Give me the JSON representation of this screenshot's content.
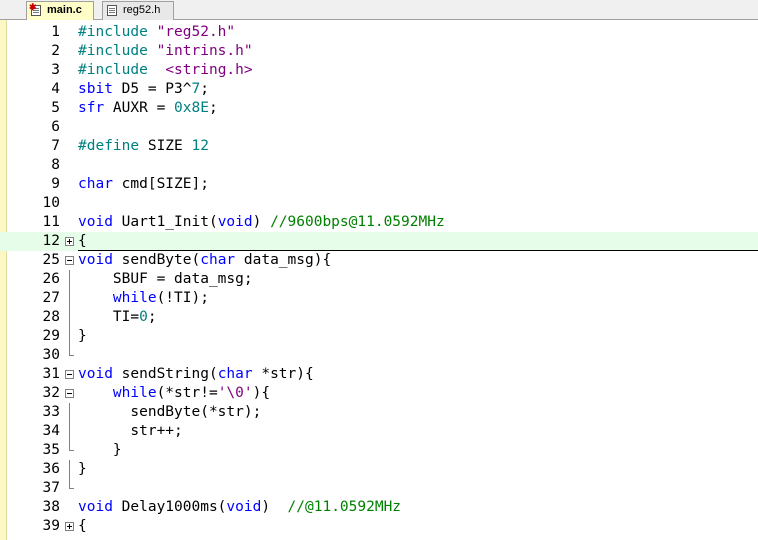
{
  "tabs": [
    {
      "label": "main.c",
      "active": true,
      "icon": "c-file-modified-icon"
    },
    {
      "label": "reg52.h",
      "active": false,
      "icon": "h-file-icon"
    }
  ],
  "colors": {
    "preprocessor": "#008080",
    "string": "#800080",
    "keyword": "#0000ff",
    "number": "#008080",
    "comment": "#008000",
    "current_line": "#e6fde9"
  },
  "lines": [
    {
      "num": "1",
      "fold": "",
      "tokens": [
        [
          "pp",
          "#include "
        ],
        [
          "str",
          "\"reg52.h\""
        ]
      ]
    },
    {
      "num": "2",
      "fold": "",
      "tokens": [
        [
          "pp",
          "#include "
        ],
        [
          "str",
          "\"intrins.h\""
        ]
      ]
    },
    {
      "num": "3",
      "fold": "",
      "tokens": [
        [
          "pp",
          "#include  "
        ],
        [
          "str",
          "<string.h>"
        ]
      ]
    },
    {
      "num": "4",
      "fold": "",
      "tokens": [
        [
          "kw",
          "sbit"
        ],
        [
          "def",
          " D5 = P3^"
        ],
        [
          "num",
          "7"
        ],
        [
          "def",
          ";"
        ]
      ]
    },
    {
      "num": "5",
      "fold": "",
      "tokens": [
        [
          "kw",
          "sfr"
        ],
        [
          "def",
          " AUXR = "
        ],
        [
          "num",
          "0x8E"
        ],
        [
          "def",
          ";"
        ]
      ]
    },
    {
      "num": "6",
      "fold": "",
      "tokens": []
    },
    {
      "num": "7",
      "fold": "",
      "tokens": [
        [
          "pp",
          "#define"
        ],
        [
          "def",
          " SIZE "
        ],
        [
          "num",
          "12"
        ]
      ]
    },
    {
      "num": "8",
      "fold": "",
      "tokens": []
    },
    {
      "num": "9",
      "fold": "",
      "tokens": [
        [
          "kw",
          "char"
        ],
        [
          "def",
          " cmd[SIZE];"
        ]
      ]
    },
    {
      "num": "10",
      "fold": "",
      "tokens": []
    },
    {
      "num": "11",
      "fold": "",
      "tokens": [
        [
          "kw",
          "void"
        ],
        [
          "def",
          " Uart1_Init("
        ],
        [
          "kw",
          "void"
        ],
        [
          "def",
          ") "
        ],
        [
          "cm",
          "//9600bps@11.0592MHz"
        ]
      ]
    },
    {
      "num": "12",
      "fold": "plus",
      "hl": true,
      "sep": true,
      "tokens": [
        [
          "def",
          "{"
        ]
      ]
    },
    {
      "num": "25",
      "fold": "minus",
      "tokens": [
        [
          "kw",
          "void"
        ],
        [
          "def",
          " sendByte("
        ],
        [
          "kw",
          "char"
        ],
        [
          "def",
          " data_msg){"
        ]
      ]
    },
    {
      "num": "26",
      "fold": "guide",
      "tokens": [
        [
          "def",
          "    SBUF = data_msg;"
        ]
      ]
    },
    {
      "num": "27",
      "fold": "guide",
      "tokens": [
        [
          "def",
          "    "
        ],
        [
          "kw",
          "while"
        ],
        [
          "def",
          "(!TI);"
        ]
      ]
    },
    {
      "num": "28",
      "fold": "guide",
      "tokens": [
        [
          "def",
          "    TI="
        ],
        [
          "num",
          "0"
        ],
        [
          "def",
          ";"
        ]
      ]
    },
    {
      "num": "29",
      "fold": "guide",
      "tokens": [
        [
          "def",
          "}"
        ]
      ]
    },
    {
      "num": "30",
      "fold": "end",
      "tokens": []
    },
    {
      "num": "31",
      "fold": "minus",
      "tokens": [
        [
          "kw",
          "void"
        ],
        [
          "def",
          " sendString("
        ],
        [
          "kw",
          "char"
        ],
        [
          "def",
          " *str){"
        ]
      ]
    },
    {
      "num": "32",
      "fold": "minus",
      "tokens": [
        [
          "def",
          "    "
        ],
        [
          "kw",
          "while"
        ],
        [
          "def",
          "(*str!="
        ],
        [
          "str",
          "'\\0'"
        ],
        [
          "def",
          "){"
        ]
      ]
    },
    {
      "num": "33",
      "fold": "guide",
      "tokens": [
        [
          "def",
          "      sendByte(*str);"
        ]
      ]
    },
    {
      "num": "34",
      "fold": "guide",
      "tokens": [
        [
          "def",
          "      str++;"
        ]
      ]
    },
    {
      "num": "35",
      "fold": "end",
      "tokens": [
        [
          "def",
          "    }"
        ]
      ]
    },
    {
      "num": "36",
      "fold": "guide",
      "tokens": [
        [
          "def",
          "}"
        ]
      ]
    },
    {
      "num": "37",
      "fold": "end",
      "tokens": []
    },
    {
      "num": "38",
      "fold": "",
      "tokens": [
        [
          "kw",
          "void"
        ],
        [
          "def",
          " Delay1000ms("
        ],
        [
          "kw",
          "void"
        ],
        [
          "def",
          ")  "
        ],
        [
          "cm",
          "//@11.0592MHz"
        ]
      ]
    },
    {
      "num": "39",
      "fold": "plus",
      "tokens": [
        [
          "def",
          "{"
        ]
      ]
    }
  ]
}
